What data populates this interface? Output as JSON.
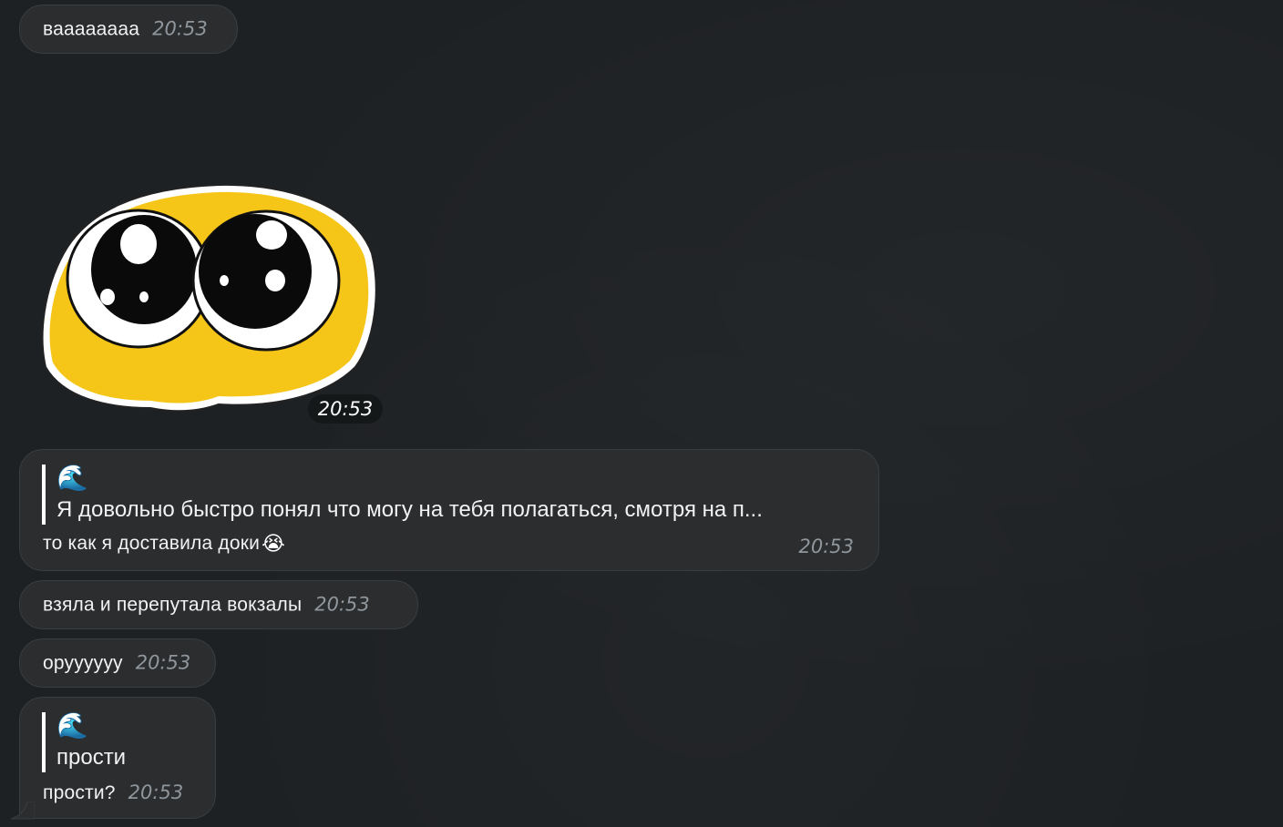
{
  "messages": [
    {
      "text": "вааааааaa",
      "time": "20:53"
    },
    {
      "sticker": "crying-smiley-sticker",
      "time": "20:53"
    },
    {
      "reply": {
        "emoji": "🌊",
        "text": "Я довольно быстро понял что могу на тебя полагаться, смотря на п..."
      },
      "text": "то как я доставила доки",
      "text_emoji": "😭",
      "time": "20:53"
    },
    {
      "text": "взяла и перепутала вокзалы",
      "time": "20:53"
    },
    {
      "text": "оруууууу",
      "time": "20:53"
    },
    {
      "reply": {
        "emoji": "🌊",
        "text": "прости"
      },
      "text": "прости?",
      "time": "20:53"
    }
  ],
  "colors": {
    "background": "#1e2124",
    "bubble": "#2b2d2f",
    "sticker_face": "#f5c518",
    "time": "#8f969c"
  }
}
